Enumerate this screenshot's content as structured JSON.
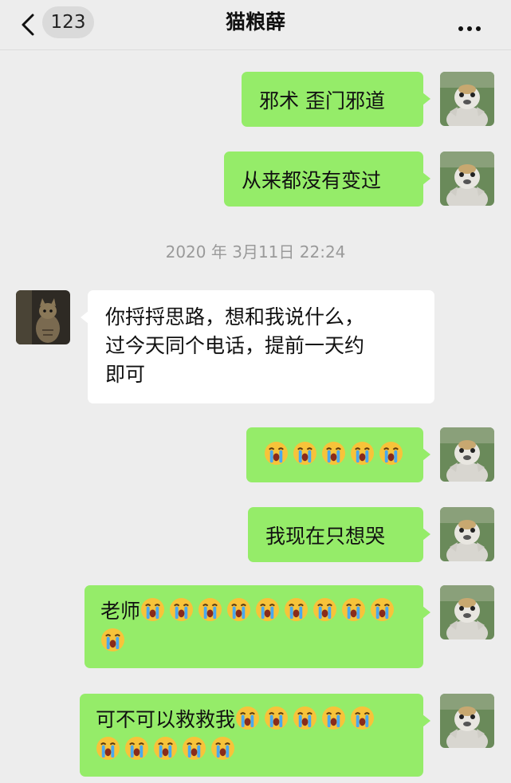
{
  "header": {
    "unread_count": "123",
    "title": "猫粮薛"
  },
  "icons": {
    "back": "chevron-left-icon",
    "more": "more-icon",
    "emoji": "crying-face-emoji"
  },
  "colors": {
    "background": "#ededed",
    "my_bubble": "#95ec69",
    "their_bubble": "#ffffff",
    "timestamp_text": "#9a9a9a"
  },
  "messages": [
    {
      "from": "me",
      "text": "邪术 歪门邪道"
    },
    {
      "from": "me",
      "text": "从来都没有变过"
    },
    {
      "from": "them",
      "text": "你捋捋思路，想和我说什么，\n过今天同个电话，提前一天约\n即可"
    },
    {
      "from": "me",
      "text": "",
      "emoji_count": 5
    },
    {
      "from": "me",
      "text": "我现在只想哭"
    },
    {
      "from": "me",
      "text": "老师",
      "emoji_count": 10
    },
    {
      "from": "me",
      "text": "可不可以救救我",
      "emoji_count": 10
    }
  ],
  "timestamp": "2020 年 3月11日 22:24"
}
